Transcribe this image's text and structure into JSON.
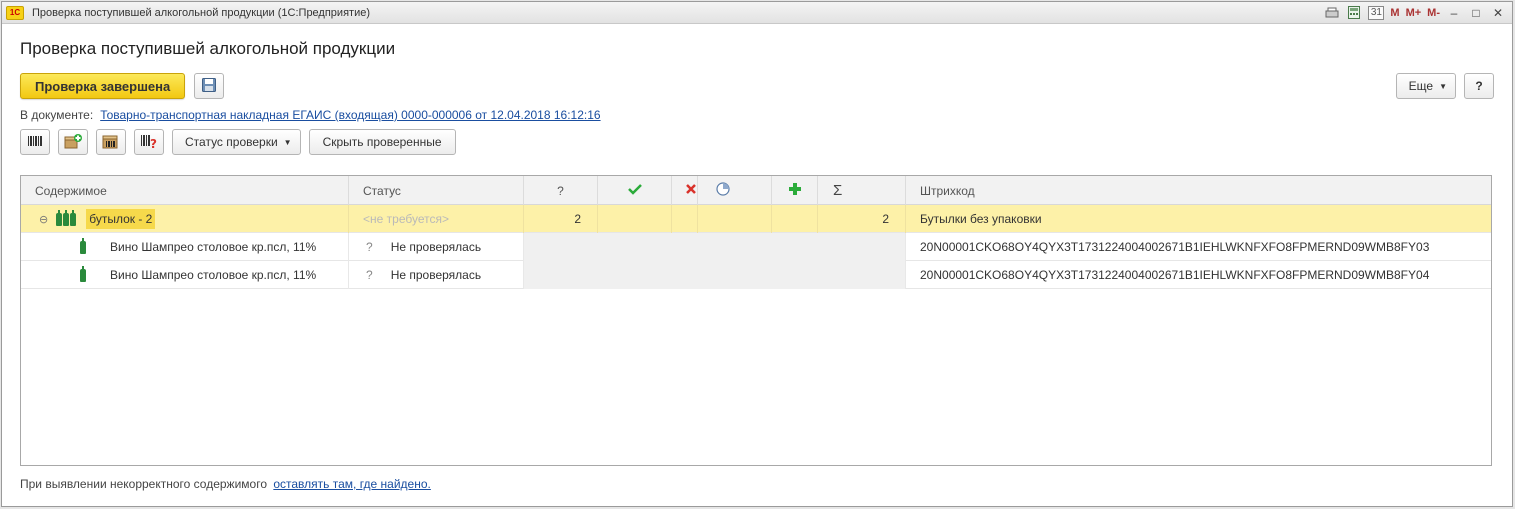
{
  "window": {
    "title": "Проверка поступившей алкогольной продукции  (1С:Предприятие)",
    "logo": "1С",
    "calendar_day": "31",
    "m_buttons": [
      "M",
      "M+",
      "M-"
    ]
  },
  "form": {
    "title": "Проверка поступившей алкогольной продукции",
    "primary_button": "Проверка завершена",
    "more_button": "Еще",
    "help_button": "?"
  },
  "document": {
    "label": "В документе:",
    "link": "Товарно-транспортная накладная ЕГАИС (входящая) 0000-000006 от 12.04.2018 16:12:16"
  },
  "toolbar": {
    "status_button": "Статус проверки",
    "hide_button": "Скрыть проверенные"
  },
  "grid": {
    "headers": {
      "content": "Содержимое",
      "status": "Статус",
      "unknown": "?",
      "barcode": "Штрихкод"
    },
    "group_row": {
      "label": "бутылок -  2",
      "status": "<не требуется>",
      "unknown_count": "2",
      "total": "2",
      "barcode": "Бутылки без упаковки"
    },
    "rows": [
      {
        "name": "Вино Шампрео столовое кр.псл, 11%",
        "status_icon": "?",
        "status": "Не проверялась",
        "barcode": "20N00001CKO68OY4QYX3T1731224004002671B1IEHLWKNFXFO8FPMERND09WMB8FY03"
      },
      {
        "name": "Вино Шампрео столовое кр.псл, 11%",
        "status_icon": "?",
        "status": "Не проверялась",
        "barcode": "20N00001CKO68OY4QYX3T1731224004002671B1IEHLWKNFXFO8FPMERND09WMB8FY04"
      }
    ]
  },
  "footer": {
    "text": "При выявлении некорректного содержимого",
    "link": "оставлять там, где найдено."
  },
  "colors": {
    "primary_button": "#f2c811",
    "selected_row": "#fdf1a8",
    "link": "#1a4ea0",
    "check_icon": "#2bab3a",
    "cross_icon": "#d9322b",
    "plus_icon": "#2bab3a"
  }
}
